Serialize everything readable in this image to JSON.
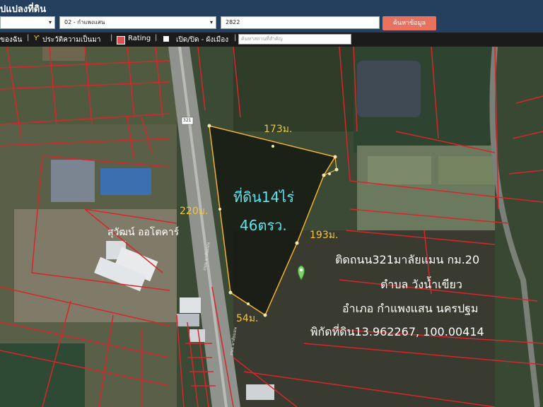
{
  "header": {
    "title": "ปแปลงที่ดิน",
    "province_select": "",
    "district_select": "02 - กำแพงแสน",
    "parcel_input": "2822",
    "search_button": "ค้นหาข้อมูล"
  },
  "toolbar": {
    "item1": "ของฉัน",
    "item2": "ประวัติความเป็นมา",
    "item3": "Rating",
    "item4": "เปิด/ปิด - ผังเมือง",
    "search_placeholder": "ค้นหาสถานที่สำคัญ"
  },
  "map": {
    "road_number": "321",
    "land_area_line1": "ที่ดิน14ไร่",
    "land_area_line2": "46ตรว.",
    "dim_top": "173ม.",
    "dim_left": "220ม.",
    "dim_right": "193ม.",
    "dim_bottom": "54ม.",
    "business_label": "สุวัฒน์ ออโตคาร์",
    "road_label_1": "ถนน มาลัยแมน",
    "road_label_2": "ถนน มาลัยแมน",
    "info_line1": "ติดถนน321มาลัยแมน กม.20",
    "info_line2": "ตำบล วังน้ำเขียว",
    "info_line3": "อำเภอ กำแพงแสน นครปฐม",
    "info_line4": "พิกัดที่ดิน13.962267, 100.00414"
  },
  "colors": {
    "header_bg": "#24405e",
    "toolbar_bg": "#1b1b1b",
    "button_bg": "#e8725f",
    "parcel_outline": "#d7262a",
    "plot_outline": "#f0b030",
    "area_text": "#5fe3f0",
    "dim_text": "#f3c43c",
    "info_text": "#ffffff"
  }
}
